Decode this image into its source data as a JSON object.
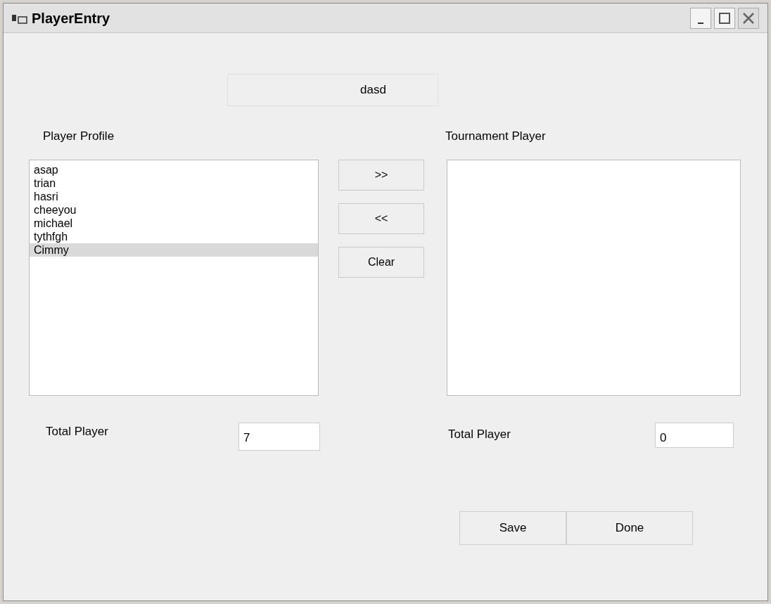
{
  "window": {
    "title": "PlayerEntry"
  },
  "heading": "dasd",
  "profile": {
    "label": "Player Profile",
    "items": [
      {
        "text": "asap",
        "selected": false
      },
      {
        "text": "trian",
        "selected": false
      },
      {
        "text": "hasri",
        "selected": false
      },
      {
        "text": "cheeyou",
        "selected": false
      },
      {
        "text": "michael",
        "selected": false
      },
      {
        "text": "tythfgh",
        "selected": false
      },
      {
        "text": "Cimmy",
        "selected": true
      }
    ],
    "total_label": "Total Player",
    "total": "7"
  },
  "tournament": {
    "label": "Tournament Player",
    "total_label": "Total Player",
    "total": "0"
  },
  "move_buttons": [
    ">>",
    "<<",
    "Clear"
  ],
  "actions": [
    "Save",
    "Done"
  ]
}
